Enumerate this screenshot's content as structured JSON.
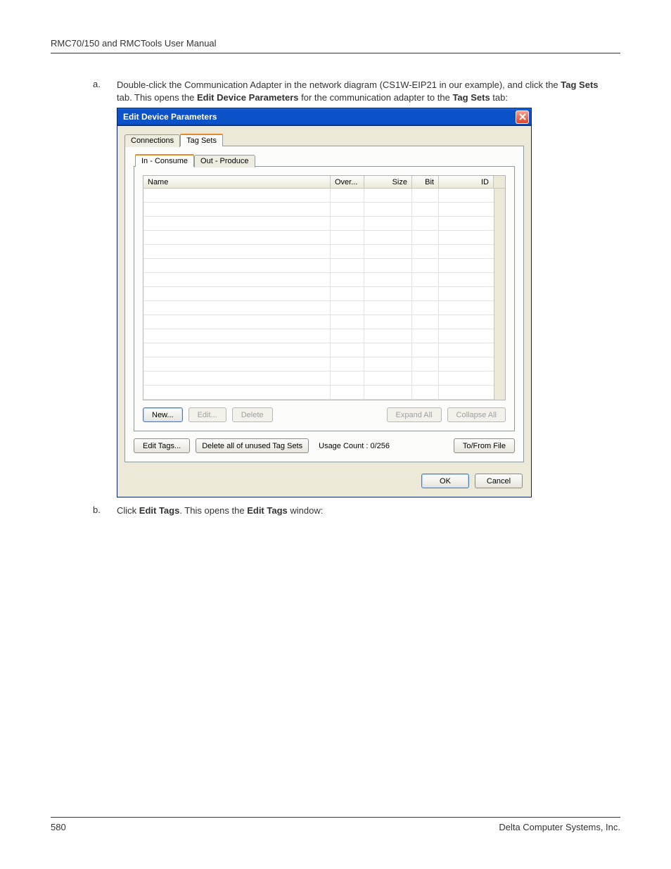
{
  "doc": {
    "header_title": "RMC70/150 and RMCTools User Manual",
    "page_number": "580",
    "footer_company": "Delta Computer Systems, Inc."
  },
  "step_a": {
    "marker": "a.",
    "text_before": "Double-click the Communication Adapter in the network diagram (CS1W-EIP21 in our example), and click the ",
    "bold1": "Tag Sets",
    "text_mid1": " tab. This opens the ",
    "bold2": "Edit Device Parameters",
    "text_mid2": " for the communication adapter to the ",
    "bold3": "Tag Sets",
    "text_after": " tab:"
  },
  "step_b": {
    "marker": "b.",
    "text_before": "Click ",
    "bold1": "Edit Tags",
    "text_mid": ". This opens the ",
    "bold2": "Edit Tags",
    "text_after": " window:"
  },
  "dialog": {
    "title": "Edit Device Parameters",
    "tabs": {
      "connections": "Connections",
      "tagsets": "Tag Sets"
    },
    "inner_tabs": {
      "in_consume": "In - Consume",
      "out_produce": "Out - Produce"
    },
    "columns": {
      "name": "Name",
      "over": "Over...",
      "size": "Size",
      "bit": "Bit",
      "id": "ID"
    },
    "buttons": {
      "new": "New...",
      "edit": "Edit...",
      "delete": "Delete",
      "expand_all": "Expand All",
      "collapse_all": "Collapse All",
      "edit_tags": "Edit Tags...",
      "delete_unused": "Delete all of unused Tag Sets",
      "to_from_file": "To/From File",
      "ok": "OK",
      "cancel": "Cancel"
    },
    "usage_count": "Usage Count :  0/256"
  }
}
